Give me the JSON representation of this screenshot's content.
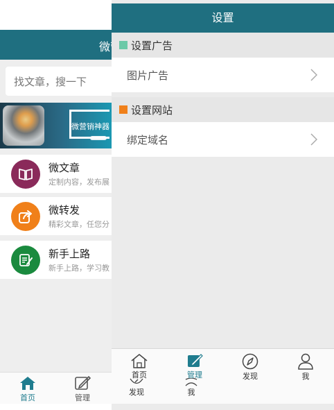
{
  "home": {
    "header_title": "微营",
    "search_placeholder": "找文章，搜一下",
    "banner_text": "微营销神器",
    "menu": [
      {
        "title": "微文章",
        "desc": "定制内容，发布展",
        "icon": "book-icon",
        "color": "#8a2a5a"
      },
      {
        "title": "微转发",
        "desc": "精彩文章，任您分",
        "icon": "share-icon",
        "color": "#f0801a"
      },
      {
        "title": "新手上路",
        "desc": "新手上路，学习教",
        "icon": "note-edit-icon",
        "color": "#1a8a3e"
      }
    ],
    "tabs": [
      {
        "label": "首页",
        "icon": "home-icon",
        "active": true
      },
      {
        "label": "管理",
        "icon": "edit-icon",
        "active": false
      }
    ]
  },
  "settings": {
    "title": "设置",
    "sections": [
      {
        "title": "设置广告",
        "color": "#6cc9a8",
        "rows": [
          {
            "label": "图片广告"
          }
        ]
      },
      {
        "title": "设置网站",
        "color": "#f0801a",
        "rows": [
          {
            "label": "绑定域名"
          }
        ]
      }
    ],
    "tabs": [
      {
        "label": "首页",
        "icon": "home-icon",
        "active": false
      },
      {
        "label": "管理",
        "icon": "edit-icon",
        "active": true
      },
      {
        "label": "发现",
        "icon": "compass-icon",
        "active": false
      },
      {
        "label": "我",
        "icon": "user-icon",
        "active": false
      }
    ],
    "ghost_tabs": [
      {
        "label": "发现",
        "icon": "compass-icon"
      },
      {
        "label": "我",
        "icon": "user-icon"
      }
    ]
  },
  "colors": {
    "brand": "#1f6f80",
    "active_tab": "#1f7c8e",
    "background": "#ebebeb"
  }
}
